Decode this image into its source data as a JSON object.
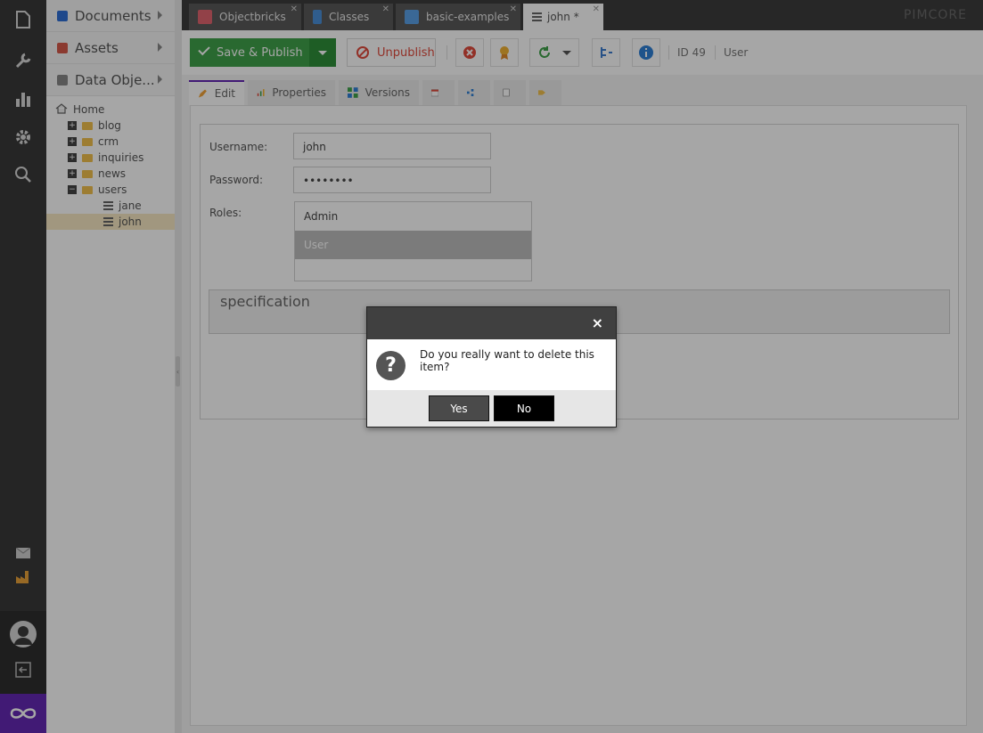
{
  "brand": "PIMCORE",
  "rail": {
    "icons": [
      "file-icon",
      "wrench-icon",
      "bar-chart-icon",
      "gear-icon",
      "search-icon"
    ],
    "bottom_icons": [
      "mail-icon",
      "factory-icon",
      "user-avatar-icon",
      "logout-icon",
      "pimcore-logo-icon"
    ]
  },
  "tree": {
    "accordions": [
      {
        "label": "Documents",
        "color": "#2f6fd6"
      },
      {
        "label": "Assets",
        "color": "#d65a4a"
      },
      {
        "label": "Data Obje...",
        "color": "#888888"
      }
    ],
    "home": "Home",
    "folders": [
      {
        "label": "blog",
        "expanded": false
      },
      {
        "label": "crm",
        "expanded": false
      },
      {
        "label": "inquiries",
        "expanded": false
      },
      {
        "label": "news",
        "expanded": false
      },
      {
        "label": "users",
        "expanded": true
      }
    ],
    "children": [
      {
        "label": "jane",
        "selected": false
      },
      {
        "label": "john",
        "selected": true
      }
    ]
  },
  "tabs": [
    {
      "label": "Objectbricks",
      "active": false
    },
    {
      "label": "Classes",
      "active": false
    },
    {
      "label": "basic-examples",
      "active": false
    },
    {
      "label": "john *",
      "active": true
    }
  ],
  "toolbar": {
    "save_label": "Save & Publish",
    "unpublish_label": "Unpublish",
    "id_text": "ID 49",
    "class_text": "User"
  },
  "subtabs": [
    {
      "label": "Edit",
      "active": true
    },
    {
      "label": "Properties",
      "active": false
    },
    {
      "label": "Versions",
      "active": false
    }
  ],
  "form": {
    "username_label": "Username:",
    "username_value": "john",
    "password_label": "Password:",
    "password_value": "••••••••",
    "roles_label": "Roles:",
    "roles": [
      {
        "label": "Admin",
        "selected": false
      },
      {
        "label": "User",
        "selected": true
      }
    ],
    "specification_label": "specification"
  },
  "dialog": {
    "message": "Do you really want to delete this item?",
    "yes_label": "Yes",
    "no_label": "No",
    "close_symbol": "×"
  }
}
